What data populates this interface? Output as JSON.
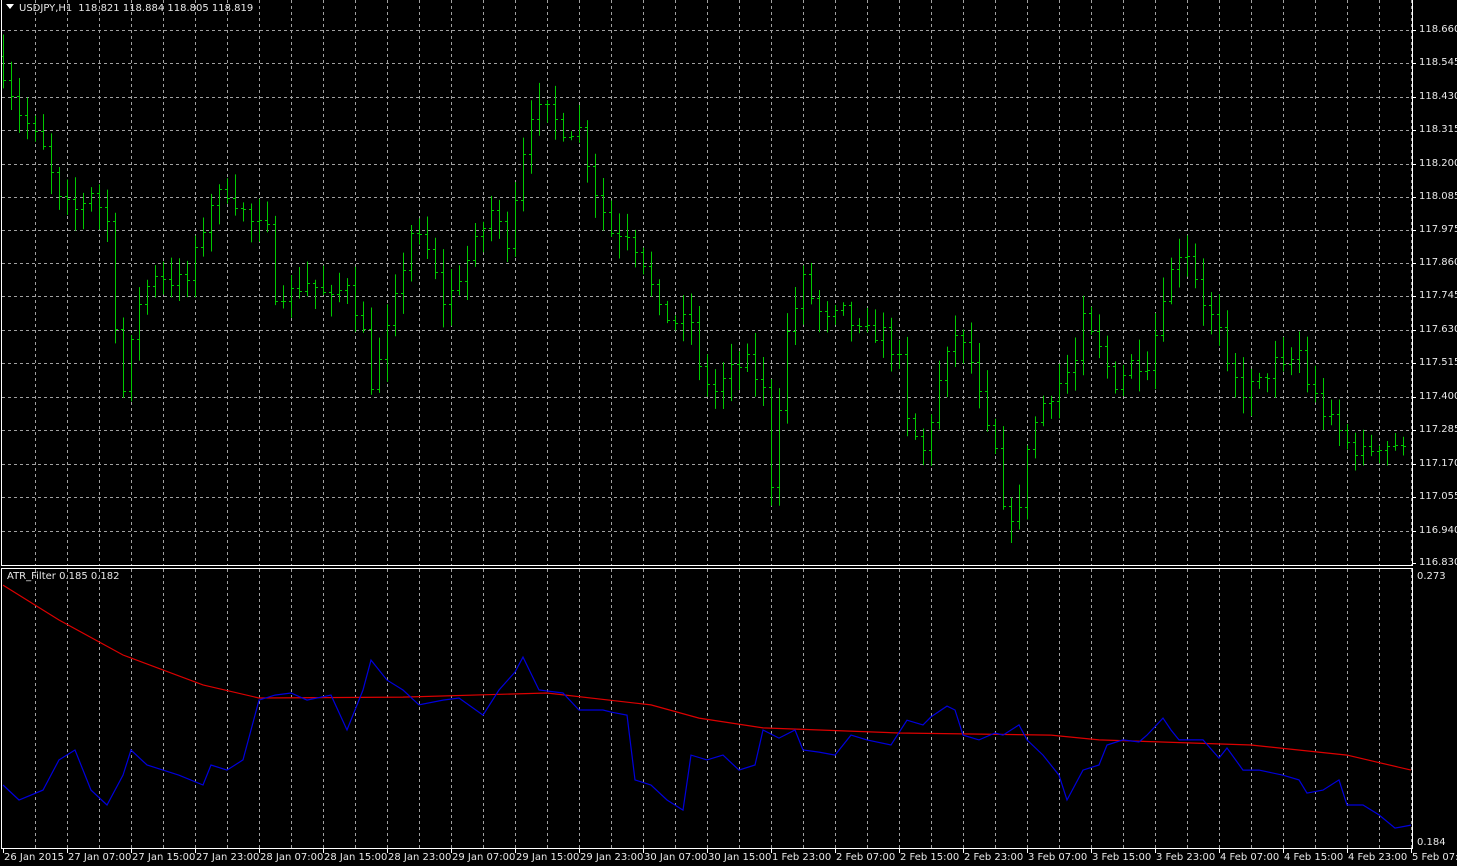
{
  "header": {
    "symbol": "USDJPY,H1",
    "ohlc": "118.821 118.884 118.805 118.819",
    "menu_icon": "triangle-down-icon"
  },
  "indicator": {
    "label": "ATR_Filter 0.185 0.182"
  },
  "colors": {
    "background": "#000000",
    "bars": "#00c800",
    "grid": "#a0a0a0",
    "atr_fast": "#0000dc",
    "atr_slow": "#dc0000",
    "frame": "#ffffff"
  },
  "chart_data": [
    {
      "type": "ohlc",
      "title": "USDJPY,H1",
      "bar_count": 176,
      "y_ticks": [
        "118.660",
        "118.545",
        "118.430",
        "118.315",
        "118.200",
        "118.085",
        "117.975",
        "117.860",
        "117.745",
        "117.630",
        "117.515",
        "117.400",
        "117.285",
        "117.170",
        "117.055",
        "116.940",
        "116.830"
      ],
      "ylim": [
        116.83,
        118.66
      ],
      "close_keypoints": [
        [
          0,
          118.52
        ],
        [
          2,
          118.38
        ],
        [
          5,
          118.25
        ],
        [
          7,
          118.07
        ],
        [
          9,
          118.04
        ],
        [
          11,
          118.11
        ],
        [
          13,
          118.0
        ],
        [
          14,
          117.66
        ],
        [
          15,
          117.42
        ],
        [
          17,
          117.73
        ],
        [
          19,
          117.83
        ],
        [
          21,
          117.8
        ],
        [
          23,
          117.8
        ],
        [
          26,
          118.07
        ],
        [
          28,
          118.11
        ],
        [
          31,
          118.0
        ],
        [
          33,
          117.97
        ],
        [
          34,
          117.76
        ],
        [
          36,
          117.76
        ],
        [
          38,
          117.8
        ],
        [
          41,
          117.73
        ],
        [
          43,
          117.8
        ],
        [
          45,
          117.62
        ],
        [
          46,
          117.45
        ],
        [
          47,
          117.52
        ],
        [
          49,
          117.73
        ],
        [
          51,
          117.97
        ],
        [
          53,
          117.9
        ],
        [
          55,
          117.73
        ],
        [
          56,
          117.76
        ],
        [
          58,
          117.87
        ],
        [
          61,
          118.04
        ],
        [
          63,
          117.94
        ],
        [
          65,
          118.25
        ],
        [
          66,
          118.38
        ],
        [
          68,
          118.38
        ],
        [
          70,
          118.32
        ],
        [
          72,
          118.32
        ],
        [
          74,
          118.11
        ],
        [
          76,
          117.97
        ],
        [
          78,
          117.97
        ],
        [
          80,
          117.87
        ],
        [
          82,
          117.69
        ],
        [
          84,
          117.66
        ],
        [
          86,
          117.66
        ],
        [
          87,
          117.49
        ],
        [
          89,
          117.42
        ],
        [
          91,
          117.49
        ],
        [
          93,
          117.52
        ],
        [
          95,
          117.42
        ],
        [
          96,
          117.11
        ],
        [
          97,
          117.38
        ],
        [
          98,
          117.62
        ],
        [
          100,
          117.8
        ],
        [
          102,
          117.69
        ],
        [
          103,
          117.66
        ],
        [
          105,
          117.69
        ],
        [
          107,
          117.62
        ],
        [
          110,
          117.62
        ],
        [
          112,
          117.52
        ],
        [
          113,
          117.31
        ],
        [
          115,
          117.21
        ],
        [
          117,
          117.45
        ],
        [
          119,
          117.62
        ],
        [
          121,
          117.52
        ],
        [
          123,
          117.28
        ],
        [
          124,
          117.21
        ],
        [
          125,
          117.0
        ],
        [
          127,
          117.0
        ],
        [
          128,
          117.24
        ],
        [
          130,
          117.38
        ],
        [
          132,
          117.45
        ],
        [
          134,
          117.52
        ],
        [
          135,
          117.66
        ],
        [
          137,
          117.56
        ],
        [
          139,
          117.45
        ],
        [
          141,
          117.52
        ],
        [
          143,
          117.52
        ],
        [
          144,
          117.62
        ],
        [
          145,
          117.76
        ],
        [
          147,
          117.9
        ],
        [
          148,
          117.9
        ],
        [
          150,
          117.73
        ],
        [
          152,
          117.62
        ],
        [
          153,
          117.49
        ],
        [
          155,
          117.42
        ],
        [
          157,
          117.45
        ],
        [
          159,
          117.52
        ],
        [
          160,
          117.49
        ],
        [
          162,
          117.56
        ],
        [
          163,
          117.45
        ],
        [
          165,
          117.35
        ],
        [
          167,
          117.28
        ],
        [
          168,
          117.24
        ],
        [
          170,
          117.21
        ],
        [
          172,
          117.24
        ],
        [
          174,
          117.24
        ],
        [
          175,
          117.21
        ]
      ]
    },
    {
      "type": "line",
      "title": "ATR_Filter",
      "y_ticks": [
        "0.273",
        "0.184"
      ],
      "ylim": [
        0.184,
        0.273
      ],
      "series": [
        {
          "name": "ATR slow",
          "color": "#dc0000",
          "points": [
            [
              0,
              0.2703
            ],
            [
              7,
              0.2586
            ],
            [
              15,
              0.2469
            ],
            [
              25,
              0.2369
            ],
            [
              32,
              0.2325
            ],
            [
              50,
              0.2328
            ],
            [
              68,
              0.2342
            ],
            [
              81,
              0.2302
            ],
            [
              87,
              0.2258
            ],
            [
              95,
              0.2225
            ],
            [
              112,
              0.2208
            ],
            [
              131,
              0.2201
            ],
            [
              137,
              0.2185
            ],
            [
              156,
              0.2168
            ],
            [
              168,
              0.2134
            ],
            [
              176,
              0.2084
            ]
          ]
        },
        {
          "name": "ATR fast",
          "color": "#0000dc",
          "points": [
            [
              0,
              0.2034
            ],
            [
              2,
              0.1984
            ],
            [
              5,
              0.2017
            ],
            [
              7,
              0.2118
            ],
            [
              9,
              0.2151
            ],
            [
              11,
              0.2017
            ],
            [
              13,
              0.1967
            ],
            [
              15,
              0.2067
            ],
            [
              16,
              0.2151
            ],
            [
              18,
              0.2101
            ],
            [
              20,
              0.2084
            ],
            [
              22,
              0.2067
            ],
            [
              25,
              0.2034
            ],
            [
              26,
              0.2101
            ],
            [
              28,
              0.2084
            ],
            [
              30,
              0.2118
            ],
            [
              32,
              0.2318
            ],
            [
              34,
              0.2335
            ],
            [
              36,
              0.2342
            ],
            [
              38,
              0.2318
            ],
            [
              41,
              0.2335
            ],
            [
              43,
              0.2218
            ],
            [
              45,
              0.2352
            ],
            [
              46,
              0.2452
            ],
            [
              48,
              0.2385
            ],
            [
              50,
              0.2352
            ],
            [
              52,
              0.2302
            ],
            [
              55,
              0.2318
            ],
            [
              57,
              0.2325
            ],
            [
              60,
              0.2268
            ],
            [
              62,
              0.2352
            ],
            [
              64,
              0.2412
            ],
            [
              65,
              0.2462
            ],
            [
              67,
              0.2352
            ],
            [
              70,
              0.2342
            ],
            [
              72,
              0.2285
            ],
            [
              75,
              0.2285
            ],
            [
              76,
              0.2278
            ],
            [
              78,
              0.2268
            ],
            [
              79,
              0.2051
            ],
            [
              81,
              0.2034
            ],
            [
              83,
              0.1984
            ],
            [
              85,
              0.195
            ],
            [
              86,
              0.2134
            ],
            [
              88,
              0.2118
            ],
            [
              90,
              0.2134
            ],
            [
              92,
              0.2084
            ],
            [
              94,
              0.2101
            ],
            [
              95,
              0.2218
            ],
            [
              97,
              0.2191
            ],
            [
              99,
              0.2218
            ],
            [
              100,
              0.2151
            ],
            [
              102,
              0.2144
            ],
            [
              104,
              0.2134
            ],
            [
              106,
              0.2201
            ],
            [
              108,
              0.2185
            ],
            [
              111,
              0.2168
            ],
            [
              113,
              0.2251
            ],
            [
              115,
              0.2235
            ],
            [
              116,
              0.2262
            ],
            [
              118,
              0.2298
            ],
            [
              119,
              0.2285
            ],
            [
              120,
              0.2201
            ],
            [
              122,
              0.2185
            ],
            [
              124,
              0.2208
            ],
            [
              125,
              0.2201
            ],
            [
              127,
              0.2235
            ],
            [
              128,
              0.2185
            ],
            [
              130,
              0.2134
            ],
            [
              132,
              0.2067
            ],
            [
              133,
              0.1984
            ],
            [
              135,
              0.2084
            ],
            [
              137,
              0.2101
            ],
            [
              138,
              0.2168
            ],
            [
              140,
              0.2185
            ],
            [
              142,
              0.2178
            ],
            [
              143,
              0.2201
            ],
            [
              145,
              0.2258
            ],
            [
              146,
              0.2218
            ],
            [
              147,
              0.2185
            ],
            [
              150,
              0.2185
            ],
            [
              152,
              0.2124
            ],
            [
              153,
              0.2158
            ],
            [
              155,
              0.2084
            ],
            [
              157,
              0.2084
            ],
            [
              160,
              0.2067
            ],
            [
              162,
              0.2051
            ],
            [
              163,
              0.2007
            ],
            [
              165,
              0.2017
            ],
            [
              167,
              0.2051
            ],
            [
              168,
              0.1967
            ],
            [
              170,
              0.1967
            ],
            [
              172,
              0.1934
            ],
            [
              174,
              0.189
            ],
            [
              176,
              0.19
            ]
          ]
        }
      ]
    }
  ],
  "time_axis": [
    "26 Jan 2015",
    "27 Jan 07:00",
    "27 Jan 15:00",
    "27 Jan 23:00",
    "28 Jan 07:00",
    "28 Jan 15:00",
    "28 Jan 23:00",
    "29 Jan 07:00",
    "29 Jan 15:00",
    "29 Jan 23:00",
    "30 Jan 07:00",
    "30 Jan 15:00",
    "1 Feb 23:00",
    "2 Feb 07:00",
    "2 Feb 15:00",
    "2 Feb 23:00",
    "3 Feb 07:00",
    "3 Feb 15:00",
    "3 Feb 23:00",
    "4 Feb 07:00",
    "4 Feb 15:00",
    "4 Feb 23:00",
    "5 Feb 07:00"
  ]
}
